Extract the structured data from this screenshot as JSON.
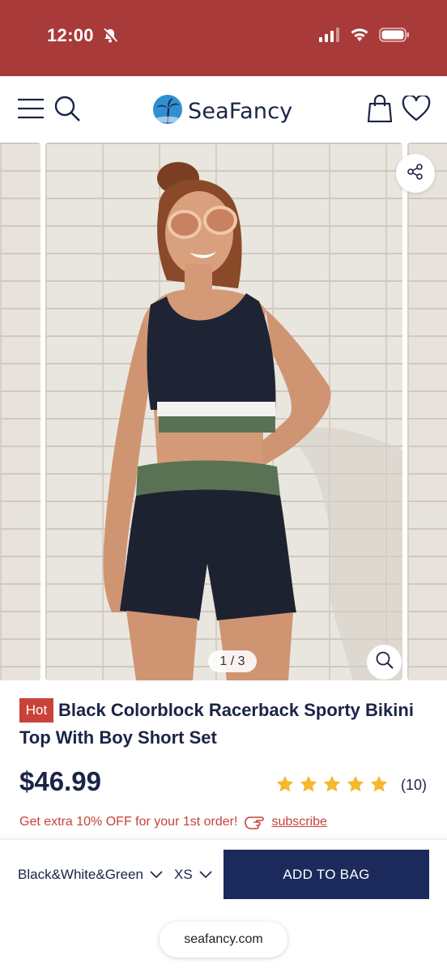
{
  "status_bar": {
    "time": "12:00",
    "icons": [
      "bell-slash-icon",
      "signal-icon",
      "wifi-icon",
      "battery-icon"
    ]
  },
  "header": {
    "brand": "SeaFancy",
    "icons": [
      "menu-icon",
      "search-icon",
      "palm-logo-icon",
      "shopping-bag-icon",
      "heart-icon"
    ]
  },
  "gallery": {
    "counter": "1 / 3",
    "icons": [
      "share-icon",
      "zoom-icon"
    ]
  },
  "product": {
    "badge": "Hot",
    "title": "Black Colorblock Racerback Sporty Bikini Top With Boy Short Set",
    "price": "$46.99",
    "rating_stars": 5,
    "review_count": "(10)",
    "promo_text": "Get extra 10% OFF for your 1st order!",
    "subscribe_label": "subscribe"
  },
  "bottom_bar": {
    "color_value": "Black&White&Green",
    "size_value": "XS",
    "add_button": "ADD TO BAG",
    "url": "seafancy.com"
  },
  "colors": {
    "status_bar": "#a83a3a",
    "navy": "#1b2447",
    "button": "#1b2a5a",
    "accent_red": "#c9423a",
    "star": "#f5b82e"
  }
}
